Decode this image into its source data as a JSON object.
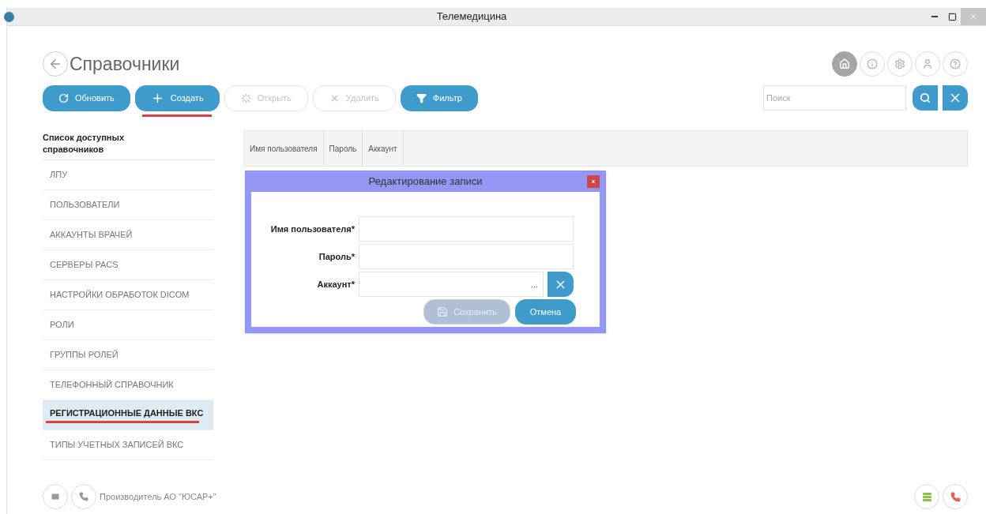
{
  "window": {
    "title": "Телемедицина"
  },
  "header": {
    "title": "Справочники"
  },
  "header_icons": [
    {
      "kind": "home",
      "selected": true
    },
    {
      "kind": "info",
      "selected": false
    },
    {
      "kind": "settings",
      "selected": false
    },
    {
      "kind": "user",
      "selected": false
    },
    {
      "kind": "help",
      "selected": false
    }
  ],
  "toolbar": [
    {
      "label": "Обновить",
      "kind": "refresh",
      "disabled": false,
      "underlined": false
    },
    {
      "label": "Создать",
      "kind": "create",
      "disabled": false,
      "underlined": true
    },
    {
      "label": "Открыть",
      "kind": "open",
      "disabled": true,
      "underlined": false
    },
    {
      "label": "Удалить",
      "kind": "delete",
      "disabled": true,
      "underlined": false
    },
    {
      "label": "Фильтр",
      "kind": "filter",
      "disabled": false,
      "underlined": false
    }
  ],
  "search": {
    "placeholder": "Поиск"
  },
  "sidebar": {
    "title": "Список доступных справочников",
    "items": [
      {
        "label": "ЛПУ",
        "selected": false,
        "underlined": false
      },
      {
        "label": "ПОЛЬЗОВАТЕЛИ",
        "selected": false,
        "underlined": false
      },
      {
        "label": "АККАУНТЫ ВРАЧЕЙ",
        "selected": false,
        "underlined": false
      },
      {
        "label": "СЕРВЕРЫ PACS",
        "selected": false,
        "underlined": false
      },
      {
        "label": "НАСТРОЙКИ ОБРАБОТОК DICOM",
        "selected": false,
        "underlined": false
      },
      {
        "label": "РОЛИ",
        "selected": false,
        "underlined": false
      },
      {
        "label": "ГРУППЫ РОЛЕЙ",
        "selected": false,
        "underlined": false
      },
      {
        "label": "ТЕЛЕФОННЫЙ СПРАВОЧНИК",
        "selected": false,
        "underlined": false
      },
      {
        "label": "РЕГИСТРАЦИОННЫЕ ДАННЫЕ ВКС",
        "selected": true,
        "underlined": true
      },
      {
        "label": "ТИПЫ УЧЕТНЫХ ЗАПИСЕЙ ВКС",
        "selected": false,
        "underlined": false
      }
    ]
  },
  "table": {
    "columns": [
      "Имя пользователя",
      "Пароль",
      "Аккаунт"
    ]
  },
  "dialog": {
    "title": "Редактирование записи",
    "close_label": "x",
    "fields": [
      {
        "label": "Имя пользователя*",
        "kind": "text"
      },
      {
        "label": "Пароль*",
        "kind": "text"
      },
      {
        "label": "Аккаунт*",
        "kind": "lookup",
        "lookup_text": "..."
      }
    ],
    "buttons": [
      {
        "label": "Сохранить",
        "kind": "save",
        "disabled": true
      },
      {
        "label": "Отмена",
        "kind": "cancel",
        "disabled": false
      }
    ]
  },
  "footer": {
    "text": "Производитель АО \"ЮСАР+\""
  }
}
